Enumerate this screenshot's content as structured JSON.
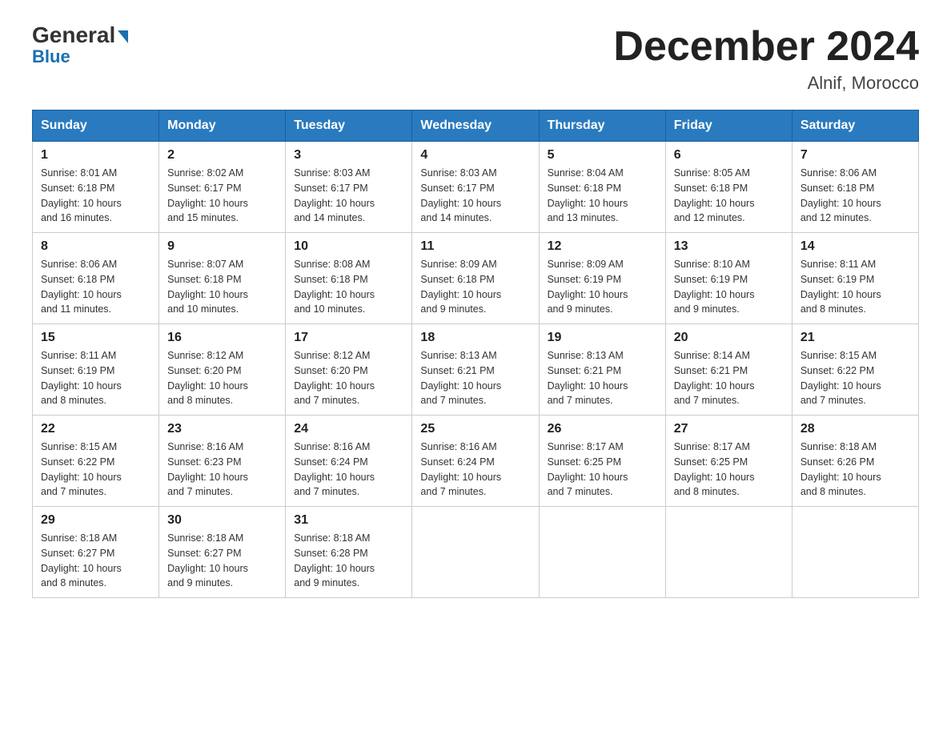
{
  "header": {
    "logo_general": "General",
    "logo_blue": "Blue",
    "month_title": "December 2024",
    "location": "Alnif, Morocco"
  },
  "days_of_week": [
    "Sunday",
    "Monday",
    "Tuesday",
    "Wednesday",
    "Thursday",
    "Friday",
    "Saturday"
  ],
  "weeks": [
    [
      {
        "day": "1",
        "info": "Sunrise: 8:01 AM\nSunset: 6:18 PM\nDaylight: 10 hours\nand 16 minutes."
      },
      {
        "day": "2",
        "info": "Sunrise: 8:02 AM\nSunset: 6:17 PM\nDaylight: 10 hours\nand 15 minutes."
      },
      {
        "day": "3",
        "info": "Sunrise: 8:03 AM\nSunset: 6:17 PM\nDaylight: 10 hours\nand 14 minutes."
      },
      {
        "day": "4",
        "info": "Sunrise: 8:03 AM\nSunset: 6:17 PM\nDaylight: 10 hours\nand 14 minutes."
      },
      {
        "day": "5",
        "info": "Sunrise: 8:04 AM\nSunset: 6:18 PM\nDaylight: 10 hours\nand 13 minutes."
      },
      {
        "day": "6",
        "info": "Sunrise: 8:05 AM\nSunset: 6:18 PM\nDaylight: 10 hours\nand 12 minutes."
      },
      {
        "day": "7",
        "info": "Sunrise: 8:06 AM\nSunset: 6:18 PM\nDaylight: 10 hours\nand 12 minutes."
      }
    ],
    [
      {
        "day": "8",
        "info": "Sunrise: 8:06 AM\nSunset: 6:18 PM\nDaylight: 10 hours\nand 11 minutes."
      },
      {
        "day": "9",
        "info": "Sunrise: 8:07 AM\nSunset: 6:18 PM\nDaylight: 10 hours\nand 10 minutes."
      },
      {
        "day": "10",
        "info": "Sunrise: 8:08 AM\nSunset: 6:18 PM\nDaylight: 10 hours\nand 10 minutes."
      },
      {
        "day": "11",
        "info": "Sunrise: 8:09 AM\nSunset: 6:18 PM\nDaylight: 10 hours\nand 9 minutes."
      },
      {
        "day": "12",
        "info": "Sunrise: 8:09 AM\nSunset: 6:19 PM\nDaylight: 10 hours\nand 9 minutes."
      },
      {
        "day": "13",
        "info": "Sunrise: 8:10 AM\nSunset: 6:19 PM\nDaylight: 10 hours\nand 9 minutes."
      },
      {
        "day": "14",
        "info": "Sunrise: 8:11 AM\nSunset: 6:19 PM\nDaylight: 10 hours\nand 8 minutes."
      }
    ],
    [
      {
        "day": "15",
        "info": "Sunrise: 8:11 AM\nSunset: 6:19 PM\nDaylight: 10 hours\nand 8 minutes."
      },
      {
        "day": "16",
        "info": "Sunrise: 8:12 AM\nSunset: 6:20 PM\nDaylight: 10 hours\nand 8 minutes."
      },
      {
        "day": "17",
        "info": "Sunrise: 8:12 AM\nSunset: 6:20 PM\nDaylight: 10 hours\nand 7 minutes."
      },
      {
        "day": "18",
        "info": "Sunrise: 8:13 AM\nSunset: 6:21 PM\nDaylight: 10 hours\nand 7 minutes."
      },
      {
        "day": "19",
        "info": "Sunrise: 8:13 AM\nSunset: 6:21 PM\nDaylight: 10 hours\nand 7 minutes."
      },
      {
        "day": "20",
        "info": "Sunrise: 8:14 AM\nSunset: 6:21 PM\nDaylight: 10 hours\nand 7 minutes."
      },
      {
        "day": "21",
        "info": "Sunrise: 8:15 AM\nSunset: 6:22 PM\nDaylight: 10 hours\nand 7 minutes."
      }
    ],
    [
      {
        "day": "22",
        "info": "Sunrise: 8:15 AM\nSunset: 6:22 PM\nDaylight: 10 hours\nand 7 minutes."
      },
      {
        "day": "23",
        "info": "Sunrise: 8:16 AM\nSunset: 6:23 PM\nDaylight: 10 hours\nand 7 minutes."
      },
      {
        "day": "24",
        "info": "Sunrise: 8:16 AM\nSunset: 6:24 PM\nDaylight: 10 hours\nand 7 minutes."
      },
      {
        "day": "25",
        "info": "Sunrise: 8:16 AM\nSunset: 6:24 PM\nDaylight: 10 hours\nand 7 minutes."
      },
      {
        "day": "26",
        "info": "Sunrise: 8:17 AM\nSunset: 6:25 PM\nDaylight: 10 hours\nand 7 minutes."
      },
      {
        "day": "27",
        "info": "Sunrise: 8:17 AM\nSunset: 6:25 PM\nDaylight: 10 hours\nand 8 minutes."
      },
      {
        "day": "28",
        "info": "Sunrise: 8:18 AM\nSunset: 6:26 PM\nDaylight: 10 hours\nand 8 minutes."
      }
    ],
    [
      {
        "day": "29",
        "info": "Sunrise: 8:18 AM\nSunset: 6:27 PM\nDaylight: 10 hours\nand 8 minutes."
      },
      {
        "day": "30",
        "info": "Sunrise: 8:18 AM\nSunset: 6:27 PM\nDaylight: 10 hours\nand 9 minutes."
      },
      {
        "day": "31",
        "info": "Sunrise: 8:18 AM\nSunset: 6:28 PM\nDaylight: 10 hours\nand 9 minutes."
      },
      null,
      null,
      null,
      null
    ]
  ]
}
